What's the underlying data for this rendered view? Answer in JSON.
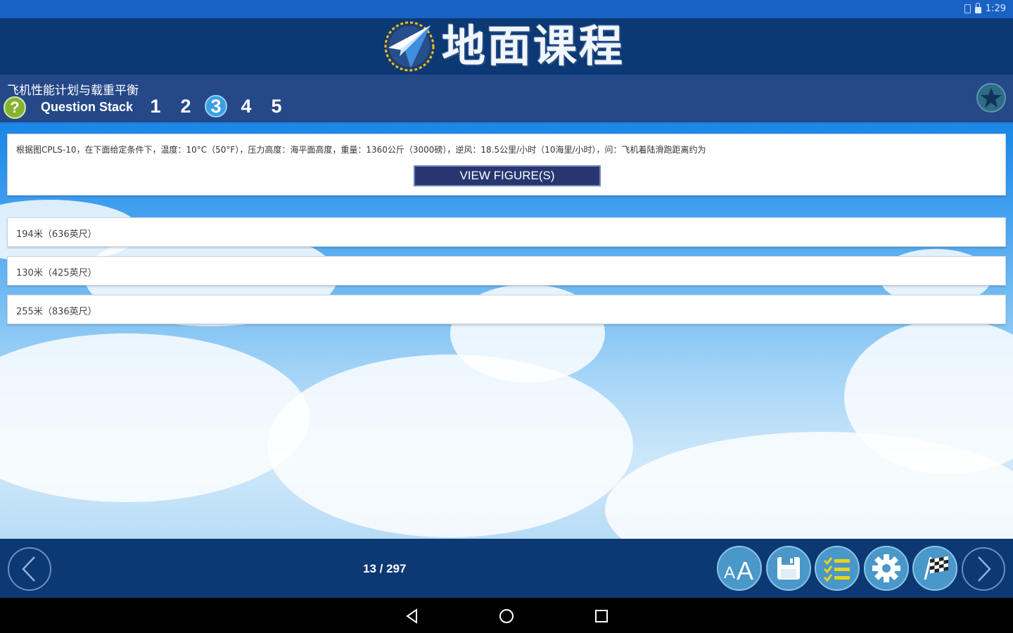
{
  "status_bar": {
    "time": "1:29"
  },
  "header": {
    "title": "地面课程"
  },
  "sub_header": {
    "category": "飞机性能计划与载重平衡",
    "help_label": "?",
    "stack_label": "Question Stack",
    "stack_numbers": [
      "1",
      "2",
      "3",
      "4",
      "5"
    ],
    "active_stack": "3"
  },
  "question": {
    "text": "根据图CPLS-10，在下面给定条件下，温度：10°C（50°F），压力高度：海平面高度，重量：1360公斤（3000磅），逆风：18.5公里/小时（10海里/小时），问：飞机着陆滑跑距离约为",
    "view_figure_label": "VIEW FIGURE(S)"
  },
  "answers": [
    {
      "text": "194米（636英尺）"
    },
    {
      "text": "130米（425英尺）"
    },
    {
      "text": "255米（836英尺）"
    }
  ],
  "bottom_bar": {
    "progress": "13 / 297"
  },
  "icons": {
    "prev": "chevron-left-icon",
    "next": "chevron-right-icon",
    "font_size": "font-size-icon",
    "save": "floppy-disk-icon",
    "list": "checklist-icon",
    "settings": "gear-icon",
    "finish": "checkered-flag-icon",
    "star": "star-icon"
  },
  "colors": {
    "header_bg": "#0c3873",
    "subheader_bg": "#254889",
    "status_bar_bg": "#1862c4",
    "button_bg": "#28366f",
    "tool_button_bg": "#4a97c9",
    "active_number_bg": "#3d9fe0",
    "help_green": "#86b233"
  }
}
